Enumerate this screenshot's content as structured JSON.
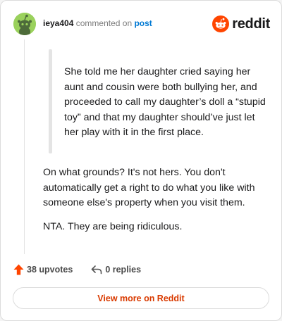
{
  "header": {
    "username": "ieya404",
    "action_text": "commented on",
    "post_link": "post",
    "logo_text": "reddit"
  },
  "comment": {
    "quote": "She told me her daughter cried saying her aunt and cousin were both bullying her, and proceeded to call my daughter’s doll a “stupid toy” and that my daughter should’ve just let her play with it in the first place.",
    "paragraphs": [
      "On what grounds? It's not hers. You don't automatically get a right to do what you like with someone else's property when you visit them.",
      "NTA. They are being ridiculous."
    ]
  },
  "actions": {
    "upvotes": "38 upvotes",
    "replies": "0 replies"
  },
  "footer": {
    "button_label": "View more on Reddit"
  },
  "colors": {
    "accent": "#d93a00",
    "link": "#0079d3",
    "reddit_orange": "#ff4500",
    "avatar_bg": "#9ad15c"
  }
}
